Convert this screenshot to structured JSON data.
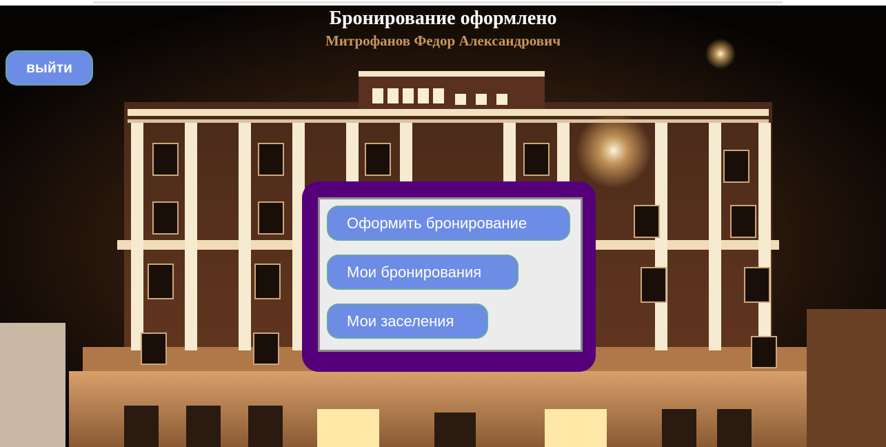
{
  "header": {
    "title": "Бронирование оформлено",
    "user_name": "Митрофанов Федор Александрович"
  },
  "logout_label": "выйти",
  "menu": {
    "items": [
      {
        "label": "Оформить бронирование"
      },
      {
        "label": "Мои бронирования"
      },
      {
        "label": "Мои заселения"
      }
    ]
  },
  "colors": {
    "button_bg": "#6c8ce6",
    "button_border": "#67a9a2",
    "panel_bg": "#55007a",
    "inner_bg": "#ececec",
    "subtitle": "#c8975a"
  },
  "background": "hotel-at-night-photo"
}
